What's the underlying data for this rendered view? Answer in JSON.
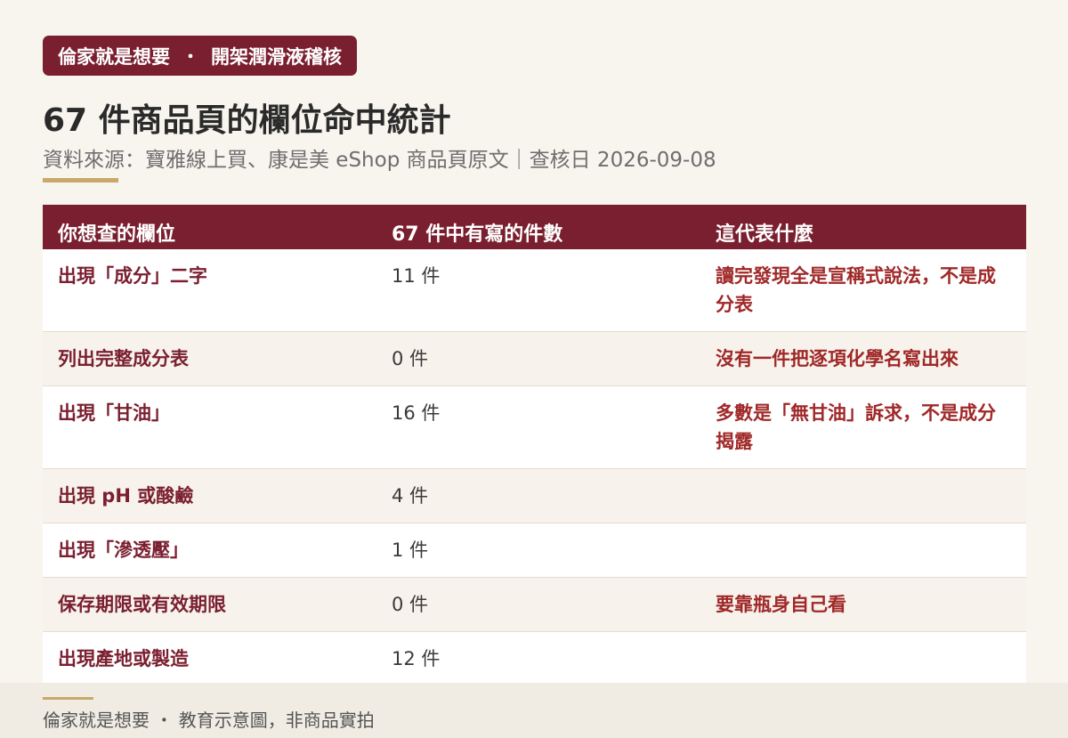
{
  "badge": {
    "brand": "倫家就是想要",
    "separator": "・",
    "topic": "開架潤滑液稽核"
  },
  "title": "67 件商品頁的欄位命中統計",
  "subtitle": "資料來源：寶雅線上買、康是美 eShop 商品頁原文｜查核日 2026-09-08",
  "table": {
    "headers": [
      "你想查的欄位",
      "67 件中有寫的件數",
      "這代表什麼"
    ],
    "rows": [
      {
        "field": "出現「成分」二字",
        "count": "11 件",
        "note": "讀完發現全是宣稱式說法，不是成分表"
      },
      {
        "field": "列出完整成分表",
        "count": "0 件",
        "note": "沒有一件把逐項化學名寫出來"
      },
      {
        "field": "出現「甘油」",
        "count": "16 件",
        "note": "多數是「無甘油」訴求，不是成分揭露"
      },
      {
        "field": "出現 pH 或酸鹼",
        "count": "4 件",
        "note": ""
      },
      {
        "field": "出現「滲透壓」",
        "count": "1 件",
        "note": ""
      },
      {
        "field": "保存期限或有效期限",
        "count": "0 件",
        "note": "要靠瓶身自己看"
      },
      {
        "field": "出現產地或製造",
        "count": "12 件",
        "note": ""
      }
    ]
  },
  "footer": "倫家就是想要 ・ 教育示意圖，非商品實拍",
  "colors": {
    "primary": "#7a1f30",
    "accent": "#c8a86b",
    "note": "#a02828",
    "background": "#f8f5ef"
  }
}
